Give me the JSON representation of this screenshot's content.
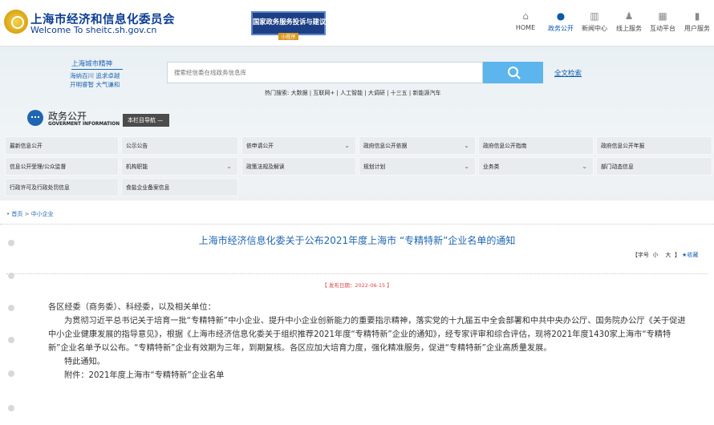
{
  "header": {
    "site_name_cn": "上海市经济和信息化委员会",
    "site_name_en": "Welcome To sheitc.sh.gov.cn",
    "banner_title": "国家政务服务投诉与建议",
    "banner_sub": "小程序",
    "nav": [
      {
        "label": "HOME",
        "icon": "home-icon",
        "active": false
      },
      {
        "label": "政务公开",
        "icon": "chat-icon",
        "active": true
      },
      {
        "label": "新闻中心",
        "icon": "book-icon",
        "active": false
      },
      {
        "label": "线上服务",
        "icon": "people-icon",
        "active": false
      },
      {
        "label": "互动平台",
        "icon": "grid-icon",
        "active": false
      },
      {
        "label": "用户服务",
        "icon": "user-service-icon",
        "active": false
      }
    ]
  },
  "hero": {
    "city_title": "上海城市精神",
    "city_lines": [
      "海纳百川  追求卓越",
      "开明睿智  大气谦和"
    ],
    "search_placeholder": "搜索经信委在线政务信息库",
    "fulltext_label": "全文检索",
    "hot_search": "热门搜索: 大数据 | 互联网+ | 人工智能 | 大调研 | 十三五 | 新能源汽车"
  },
  "gov": {
    "title_cn": "政务公开",
    "title_en": "GOVERMENT INFORMATION",
    "nav_label": "本栏目导航 —"
  },
  "grid": [
    {
      "label": "最新信息公开",
      "dropdown": false
    },
    {
      "label": "公示公告",
      "dropdown": false
    },
    {
      "label": "依申请公开",
      "dropdown": true
    },
    {
      "label": "政府信息公开依据",
      "dropdown": true
    },
    {
      "label": "政府信息公开指南",
      "dropdown": false
    },
    {
      "label": "政府信息公开年报",
      "dropdown": false
    },
    {
      "label": "信息公开受理/公众监督",
      "dropdown": false
    },
    {
      "label": "机构职能",
      "dropdown": true
    },
    {
      "label": "政策法规及解读",
      "dropdown": false
    },
    {
      "label": "规划计划",
      "dropdown": true
    },
    {
      "label": "业务类",
      "dropdown": true
    },
    {
      "label": "部门动态信息",
      "dropdown": false
    },
    {
      "label": "行政许可及行政处罚信息",
      "dropdown": false
    },
    {
      "label": "食盐企业备案信息",
      "dropdown": false
    }
  ],
  "breadcrumb": {
    "home": "首页",
    "sep": " > ",
    "current": "中小企业"
  },
  "article": {
    "title": "上海市经济信息化委关于公布2021年度上海市 “专精特新”企业名单的通知",
    "fontbar": {
      "prefix": "【字号",
      "small": "小",
      "large": "大",
      "suffix": "】",
      "fav": "★收藏"
    },
    "date": "【 发布日期：2022-06-15 】",
    "paragraphs": [
      "各区经委（商务委）、科经委，以及相关单位：",
      "为贯彻习近平总书记关于培育一批“专精特新”中小企业、提升中小企业创新能力的重要指示精神，落实党的十九届五中全会部署和中共中央办公厅、国务院办公厅《关于促进中小企业健康发展的指导意见》，根据《上海市经济信息化委关于组织推荐2021年度“专精特新”企业的通知》，经专家评审和综合评估，现将2021年度1430家上海市“专精特新”企业名单予以公布。“专精特新”企业有效期为三年，到期复核。各区应加大培育力度，强化精准服务，促进“专精特新”企业高质量发展。",
      "特此通知。",
      "附件：2021年度上海市“专精特新”企业名单"
    ]
  },
  "colors": {
    "accent": "#1f66b1",
    "search_button": "#5cb5ec",
    "date": "#dd4444"
  }
}
